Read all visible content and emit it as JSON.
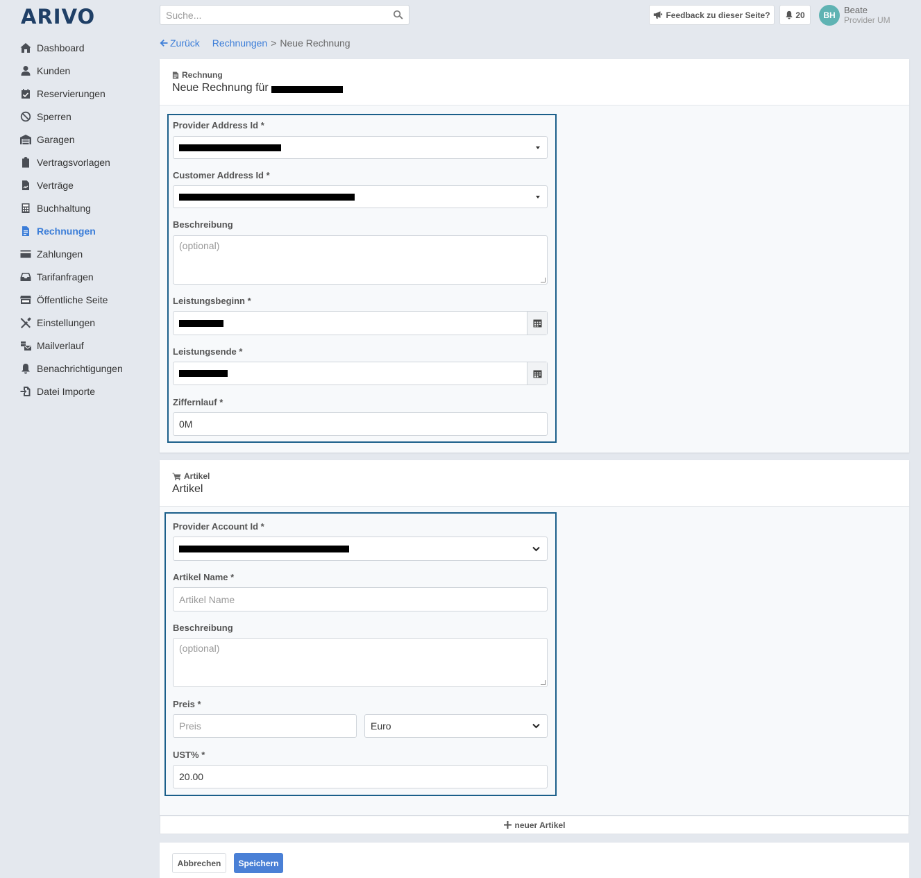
{
  "app": {
    "logo": "ARIVO"
  },
  "sidebar": {
    "items": [
      {
        "label": "Dashboard",
        "icon": "home-icon"
      },
      {
        "label": "Kunden",
        "icon": "user-icon"
      },
      {
        "label": "Reservierungen",
        "icon": "calendar-check-icon"
      },
      {
        "label": "Sperren",
        "icon": "ban-icon"
      },
      {
        "label": "Garagen",
        "icon": "warehouse-icon"
      },
      {
        "label": "Vertragsvorlagen",
        "icon": "clipboard-icon"
      },
      {
        "label": "Verträge",
        "icon": "file-signature-icon"
      },
      {
        "label": "Buchhaltung",
        "icon": "calculator-icon"
      },
      {
        "label": "Rechnungen",
        "icon": "file-invoice-icon",
        "active": true
      },
      {
        "label": "Zahlungen",
        "icon": "credit-card-icon"
      },
      {
        "label": "Tarifanfragen",
        "icon": "inbox-icon"
      },
      {
        "label": "Öffentliche Seite",
        "icon": "store-icon"
      },
      {
        "label": "Einstellungen",
        "icon": "tools-icon"
      },
      {
        "label": "Mailverlauf",
        "icon": "mail-bulk-icon"
      },
      {
        "label": "Benachrichtigungen",
        "icon": "bell-icon"
      },
      {
        "label": "Datei Importe",
        "icon": "file-import-icon"
      }
    ]
  },
  "topbar": {
    "search_placeholder": "Suche...",
    "feedback_label": "Feedback zu dieser Seite?",
    "notification_count": "20",
    "user_initials": "BH",
    "user_name": "Beate",
    "user_role": "Provider UM"
  },
  "breadcrumb": {
    "back_label": "Zurück",
    "parent": "Rechnungen",
    "separator": ">",
    "current": "Neue Rechnung"
  },
  "invoice_panel": {
    "subtitle": "Rechnung",
    "title": "Neue Rechnung für",
    "fields": {
      "provider_address_label": "Provider Address Id",
      "customer_address_label": "Customer Address Id",
      "description_label": "Beschreibung",
      "description_placeholder": "(optional)",
      "start_label": "Leistungsbeginn",
      "end_label": "Leistungsende",
      "sequence_label": "Ziffernlauf",
      "sequence_value": "0M"
    }
  },
  "article_panel": {
    "subtitle": "Artikel",
    "title": "Artikel",
    "fields": {
      "account_label": "Provider Account Id",
      "name_label": "Artikel Name",
      "name_placeholder": "Artikel Name",
      "description_label": "Beschreibung",
      "description_placeholder": "(optional)",
      "price_label": "Preis",
      "price_placeholder": "Preis",
      "currency_value": "Euro",
      "vat_label": "UST%",
      "vat_value": "20.00"
    }
  },
  "required_mark": "*",
  "add_article_label": "neuer Artikel",
  "actions": {
    "cancel_label": "Abbrechen",
    "save_label": "Speichern"
  },
  "colors": {
    "accent": "#3b7dd8",
    "save_button": "#4a80d6",
    "form_border": "#1b5f8a",
    "logo": "#1f3f66"
  }
}
